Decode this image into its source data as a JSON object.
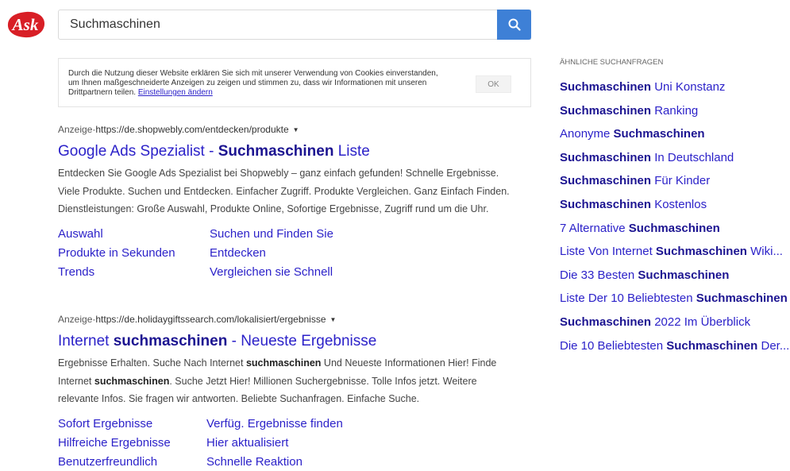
{
  "brand": {
    "logo_text": "Ask",
    "logo_color": "#d81f26"
  },
  "search": {
    "value": "Suchmaschinen",
    "button_icon": "search-icon",
    "button_color": "#3e80d6"
  },
  "cookie": {
    "text": "Durch die Nutzung dieser Website erklären Sie sich mit unserer Verwendung von Cookies einverstanden, um Ihnen maßgeschneiderte Anzeigen zu zeigen und stimmen zu, dass wir Informationen mit unseren Drittpartnern teilen.",
    "link": "Einstellungen ändern",
    "ok": "OK"
  },
  "ads": [
    {
      "label": "Anzeige",
      "separator": " · ",
      "url": "https://de.shopwebly.com/entdecken/produkte",
      "title_pre": "Google Ads Spezialist - ",
      "title_bold": "Suchmaschinen",
      "title_post": " Liste",
      "desc_parts": [
        {
          "t": "Entdecken Sie Google Ads Spezialist bei Shopwebly – ganz einfach gefunden! Schnelle Ergebnisse. Viele Produkte. Suchen und Entdecken. Einfacher Zugriff. Produkte Vergleichen. Ganz Einfach Finden. Dienstleistungen: Große Auswahl, Produkte Online, Sofortige Ergebnisse, Zugriff rund um die Uhr."
        }
      ],
      "sitelinks": [
        "Auswahl",
        "Suchen und Finden Sie",
        "Produkte in Sekunden",
        "Entdecken",
        "Trends",
        "Vergleichen sie Schnell"
      ]
    },
    {
      "label": "Anzeige",
      "separator": " · ",
      "url": "https://de.holidaygiftssearch.com/lokalisiert/ergebnisse",
      "title_pre": "Internet ",
      "title_bold": "suchmaschinen",
      "title_post": " - Neueste Ergebnisse",
      "desc_parts": [
        {
          "t": "Ergebnisse Erhalten. Suche Nach Internet "
        },
        {
          "t": "suchmaschinen",
          "b": true
        },
        {
          "t": " Und Neueste Informationen Hier! Finde Internet "
        },
        {
          "t": "suchmaschinen",
          "b": true
        },
        {
          "t": ". Suche Jetzt Hier! Millionen Suchergebnisse. Tolle Infos jetzt. Weitere relevante Infos. Sie fragen wir antworten. Beliebte Suchanfragen. Einfache Suche."
        }
      ],
      "sitelinks": [
        "Sofort Ergebnisse",
        "Verfüg. Ergebnisse finden",
        "Hilfreiche Ergebnisse",
        "Hier aktualisiert",
        "Benutzerfreundlich",
        "Schnelle Reaktion"
      ]
    }
  ],
  "related": {
    "heading": "Ähnliche Suchanfragen",
    "items": [
      [
        {
          "t": "Suchmaschinen",
          "b": true
        },
        {
          "t": " Uni Konstanz"
        }
      ],
      [
        {
          "t": "Suchmaschinen",
          "b": true
        },
        {
          "t": " Ranking"
        }
      ],
      [
        {
          "t": "Anonyme "
        },
        {
          "t": "Suchmaschinen",
          "b": true
        }
      ],
      [
        {
          "t": "Suchmaschinen",
          "b": true
        },
        {
          "t": " In Deutschland"
        }
      ],
      [
        {
          "t": "Suchmaschinen",
          "b": true
        },
        {
          "t": " Für Kinder"
        }
      ],
      [
        {
          "t": "Suchmaschinen",
          "b": true
        },
        {
          "t": " Kostenlos"
        }
      ],
      [
        {
          "t": "7 Alternative "
        },
        {
          "t": "Suchmaschinen",
          "b": true
        }
      ],
      [
        {
          "t": "Liste Von Internet "
        },
        {
          "t": "Suchmaschinen",
          "b": true
        },
        {
          "t": " Wiki..."
        }
      ],
      [
        {
          "t": "Die 33 Besten "
        },
        {
          "t": "Suchmaschinen",
          "b": true
        }
      ],
      [
        {
          "t": "Liste Der 10 Beliebtesten "
        },
        {
          "t": "Suchmaschinen",
          "b": true
        }
      ],
      [
        {
          "t": "Suchmaschinen",
          "b": true
        },
        {
          "t": " 2022 Im Überblick"
        }
      ],
      [
        {
          "t": "Die 10 Beliebtesten "
        },
        {
          "t": "Suchmaschinen",
          "b": true
        },
        {
          "t": " Der..."
        }
      ]
    ]
  }
}
